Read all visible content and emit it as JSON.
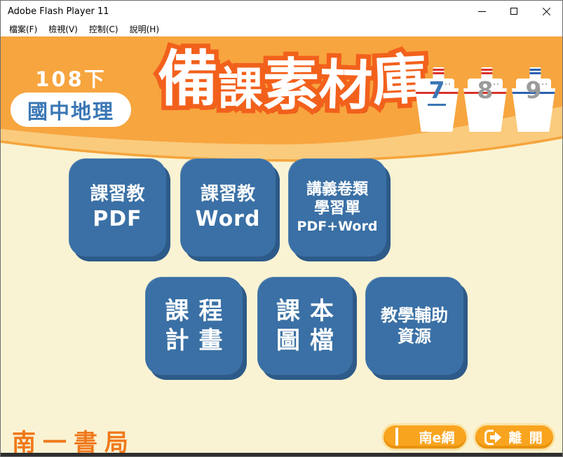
{
  "window": {
    "title": "Adobe Flash Player 11",
    "controls": {
      "minimize": "minimize-icon",
      "maximize": "maximize-icon",
      "close": "close-icon"
    }
  },
  "menu": {
    "items": [
      {
        "label": "檔案(F)"
      },
      {
        "label": "檢視(V)"
      },
      {
        "label": "控制(C)"
      },
      {
        "label": "說明(H)"
      }
    ]
  },
  "header": {
    "semester": "108下",
    "subject": "國中地理",
    "title": "備課素材庫",
    "grade_tabs": [
      {
        "number": "7",
        "active": true,
        "accent": "#D8342B",
        "icon": "boat-icon"
      },
      {
        "number": "8",
        "active": false,
        "accent": "#D8342B",
        "icon": "boat-icon"
      },
      {
        "number": "9",
        "active": false,
        "accent": "#2B62B0",
        "icon": "boat-icon"
      }
    ]
  },
  "main": {
    "buttons": [
      {
        "id": "kexijiao-pdf",
        "lines": [
          "課習教",
          "PDF"
        ]
      },
      {
        "id": "kexijiao-word",
        "lines": [
          "課習教",
          "Word"
        ]
      },
      {
        "id": "handout-sheets",
        "lines": [
          "講義卷類",
          "學習單",
          "PDF+Word"
        ]
      },
      {
        "id": "course-plan",
        "lines": [
          "課程",
          "計畫"
        ]
      },
      {
        "id": "textbook-images",
        "lines": [
          "課本",
          "圖檔"
        ]
      },
      {
        "id": "teaching-aids",
        "lines": [
          "教學輔助",
          "資源"
        ]
      }
    ]
  },
  "footer": {
    "logo": "南一書局",
    "nan_e_label": "南e網",
    "exit_label": "離 開"
  },
  "colors": {
    "header_orange": "#F7A53F",
    "wave_light": "#FACB7D",
    "body_cream": "#FAF3D3",
    "title_fill": "#FFFFFF",
    "title_outline": "#F2611C",
    "button_blue": "#3A70A5",
    "button_blue_shadow": "#2D5A88",
    "pill_orange": "#F9A41F",
    "pill_border": "#FBE2A4",
    "logo_orange": "#F0791C",
    "active_number_blue": "#3B77B5",
    "inactive_number_gray": "#9B9B9B"
  }
}
